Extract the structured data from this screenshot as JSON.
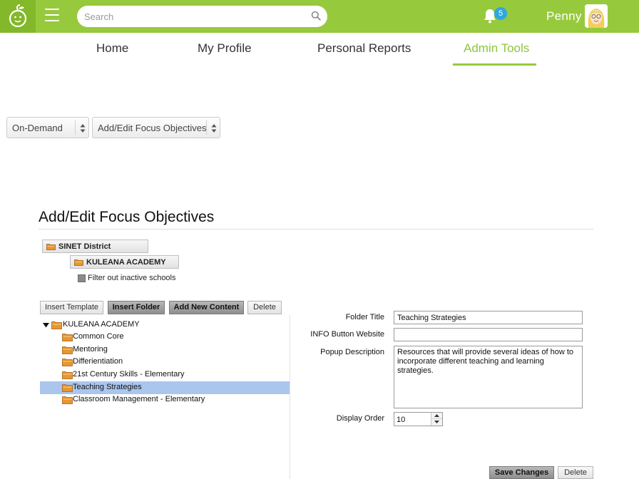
{
  "header": {
    "search_placeholder": "Search",
    "notification_count": "5",
    "user_name": "Penny",
    "brand_color": "#97c93d"
  },
  "nav": {
    "items": [
      {
        "label": "Home",
        "active": false
      },
      {
        "label": "My Profile",
        "active": false
      },
      {
        "label": "Personal Reports",
        "active": false
      },
      {
        "label": "Admin Tools",
        "active": true
      }
    ]
  },
  "selects": {
    "category": "On-Demand",
    "page": "Add/Edit Focus Objectives"
  },
  "page": {
    "title": "Add/Edit Focus Objectives",
    "district": "SINET District",
    "school": "KULEANA ACADEMY",
    "filter_label": "Filter out inactive schools"
  },
  "toolbar": {
    "insert_template": "Insert Template",
    "insert_folder": "Insert Folder",
    "add_new_content": "Add New Content",
    "delete": "Delete"
  },
  "tree": {
    "root": "KULEANA ACADEMY",
    "items": [
      {
        "label": "Common Core",
        "selected": false
      },
      {
        "label": "Mentoring",
        "selected": false
      },
      {
        "label": "Differientiation",
        "selected": false
      },
      {
        "label": "21st Century Skills - Elementary",
        "selected": false
      },
      {
        "label": "Teaching Strategies",
        "selected": true
      },
      {
        "label": "Classroom Management - Elementary",
        "selected": false
      }
    ]
  },
  "form": {
    "folder_title_label": "Folder Title",
    "folder_title_value": "Teaching Strategies",
    "info_label": "INFO Button Website",
    "info_value": "",
    "popup_label": "Popup Description",
    "popup_value": "Resources that will provide several ideas of how to incorporate different teaching and learning strategies.",
    "order_label": "Display Order",
    "order_value": "10",
    "save_label": "Save Changes",
    "delete_label": "Delete"
  }
}
